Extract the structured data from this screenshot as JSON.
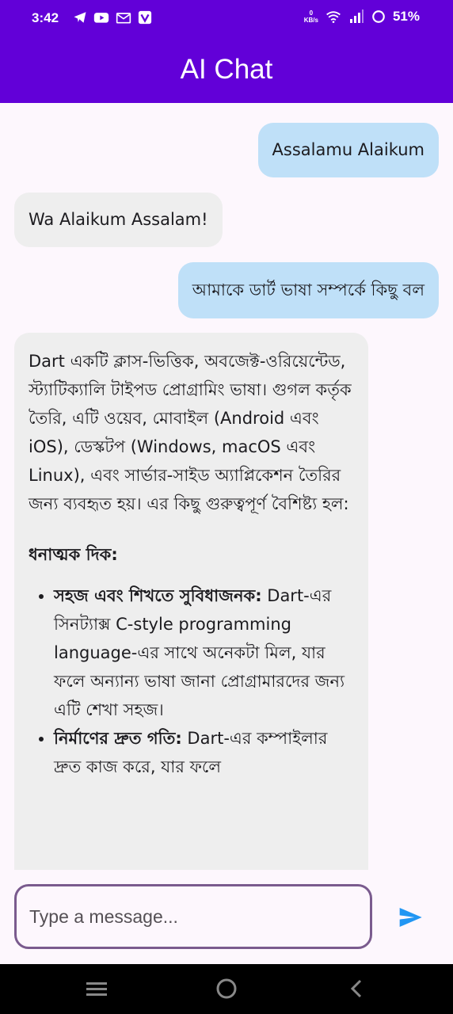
{
  "status_bar": {
    "time": "3:42",
    "left_icons": [
      "telegram-icon",
      "youtube-icon",
      "gmail-icon",
      "vpn-app-icon"
    ],
    "net_speed_value": "0",
    "net_speed_unit": "KB/s",
    "right_icons": [
      "wifi-icon",
      "signal-icon",
      "battery-icon"
    ],
    "battery": "51%"
  },
  "app_bar": {
    "title": "AI Chat",
    "color": "#6200d8"
  },
  "messages": [
    {
      "role": "user",
      "text": "Assalamu Alaikum"
    },
    {
      "role": "bot",
      "text": "Wa Alaikum Assalam!"
    },
    {
      "role": "user",
      "text": "আমাকে ডার্ট ভাষা সম্পর্কে কিছু বল"
    },
    {
      "role": "bot",
      "intro": "Dart একটি ক্লাস-ভিত্তিক, অবজেক্ট-ওরিয়েন্টেড, স্ট্যাটিক্যালি টাইপড প্রোগ্রামিং ভাষা। গুগল কর্তৃক তৈরি, এটি ওয়েব, মোবাইল (Android এবং iOS), ডেস্কটপ (Windows, macOS এবং Linux), এবং সার্ভার-সাইড অ্যাপ্লিকেশন তৈরির জন্য ব্যবহৃত হয়।  এর কিছু গুরুত্বপূর্ণ বৈশিষ্ট্য হল:",
      "heading": "ধনাত্মক দিক:",
      "points": [
        {
          "title": "সহজ এবং শিখতে সুবিধাজনক:",
          "text": " Dart-এর সিনট্যাক্স C-style programming language-এর সাথে অনেকটা মিল, যার ফলে অন্যান্য ভাষা জানা প্রোগ্রামারদের জন্য এটি শেখা সহজ।"
        },
        {
          "title": "নির্মাণের দ্রুত গতি:",
          "text": " Dart-এর কম্পাইলার দ্রুত কাজ করে, যার ফলে"
        }
      ]
    }
  ],
  "input": {
    "placeholder": "Type a message...",
    "value": ""
  },
  "colors": {
    "user_bubble": "#bfe0f8",
    "bot_bubble": "#eeeeee",
    "send": "#2196f3",
    "input_border": "#7a5b8e"
  },
  "send_icon": "send-icon",
  "nav_bar": {
    "icons": [
      "recent-apps-icon",
      "home-icon",
      "back-icon"
    ]
  }
}
